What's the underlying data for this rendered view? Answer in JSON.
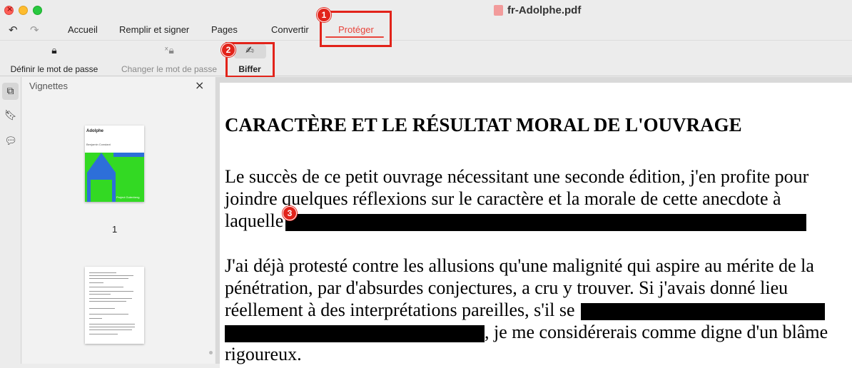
{
  "window": {
    "title": "fr-Adolphe.pdf"
  },
  "menu": {
    "undo_icon": "undo-icon",
    "redo_icon": "redo-icon",
    "items": [
      "Accueil",
      "Remplir et signer",
      "Pages",
      "Convertir",
      "Protéger"
    ],
    "active": "Protéger"
  },
  "toolbar": {
    "set_password": "Définir le mot de passe",
    "change_password": "Changer le mot de passe",
    "redact": "Biffer"
  },
  "callouts": [
    "1",
    "2",
    "3"
  ],
  "sidebar": {
    "title": "Vignettes",
    "thumbnails": [
      {
        "page": "1",
        "cover_title": "Adolphe",
        "cover_author": "Benjamin Constant",
        "cover_footer": "Project Gutenberg"
      }
    ]
  },
  "document": {
    "heading": "CARACTÈRE ET LE RÉSULTAT MORAL DE L'OUVRAGE",
    "p1": {
      "line1": "Le succès de ce petit ouvrage nécessitant une seconde édition, j'en profite pour",
      "line2": "joindre quelques réflexions sur le caractère et la morale de cette anecdote à",
      "line3_start": "laquelle"
    },
    "p2": {
      "line1": "J'ai déjà protesté contre les allusions qu'une malignité qui aspire au mérite de la",
      "line2": "pénétration, par d'absurdes conjectures, a cru y trouver. Si j'avais donné lieu",
      "line3_start": "réellement à des interprétations pareilles, s'il se",
      "line4_end": ", je me considérerais comme digne d'un blâme",
      "line5": "rigoureux."
    }
  },
  "colors": {
    "accent": "#e8453c",
    "callout": "#e2231a",
    "redaction": "#000000"
  }
}
